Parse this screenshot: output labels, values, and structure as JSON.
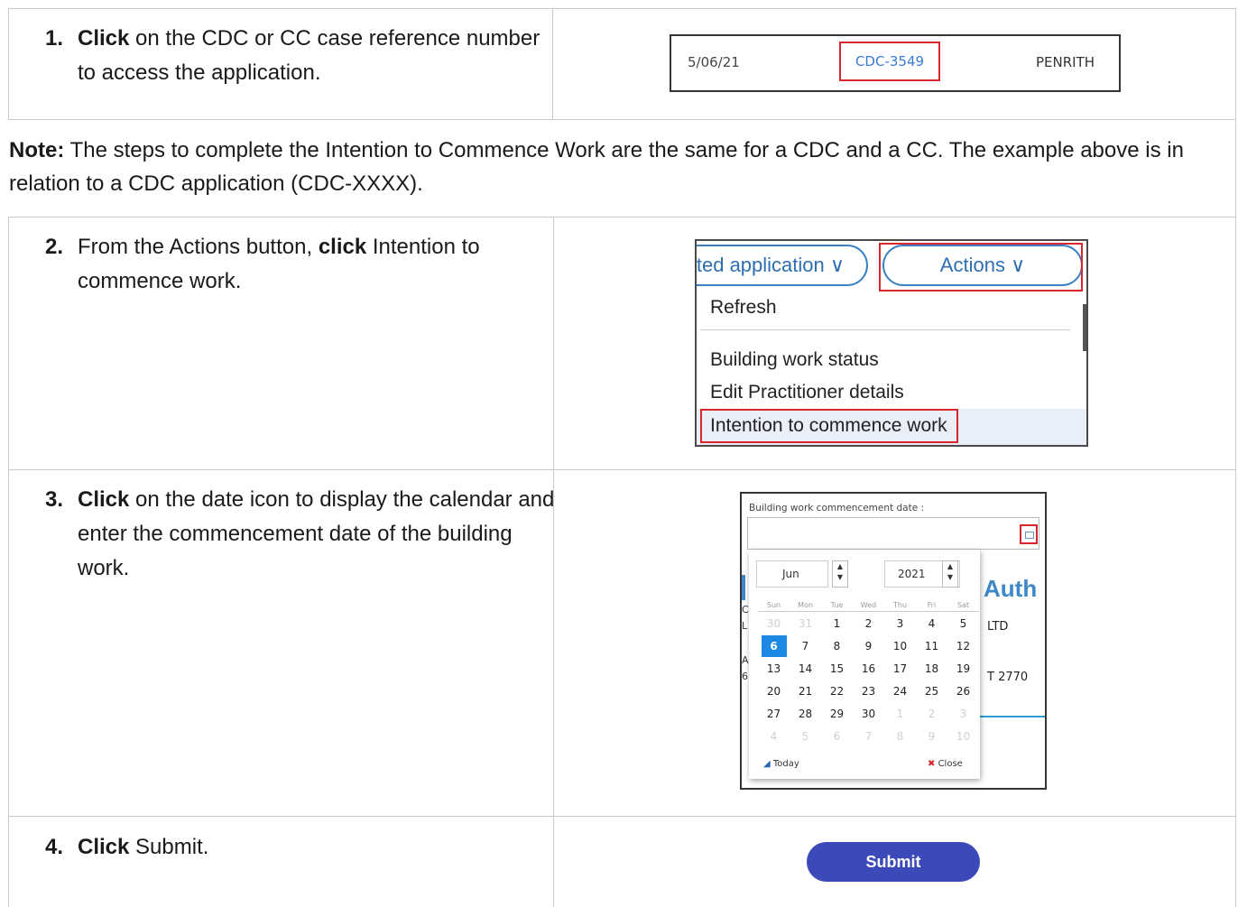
{
  "steps": [
    {
      "num": "1.",
      "bold": "Click",
      "text": " on the CDC or CC case reference number to access the application."
    },
    {
      "num": "2.",
      "pre": "From the Actions button, ",
      "bold": "click",
      "text": " Intention to commence work."
    },
    {
      "num": "3.",
      "bold": "Click",
      "text": " on the date icon to display the calendar and enter the commencement date of the building work."
    },
    {
      "num": "4.",
      "bold": "Click",
      "text": " Submit."
    }
  ],
  "note": {
    "label": "Note:",
    "text": "  The steps to complete the Intention to Commence Work are the same for a CDC and a CC. The example above is in relation to a CDC application (CDC-XXXX)."
  },
  "shot1": {
    "date": "5/06/21",
    "reference": "CDC-3549",
    "location": "PENRITH"
  },
  "shot2": {
    "related_button": "ted application",
    "actions_button": "Actions",
    "menu_items": [
      "Refresh",
      "Building work status",
      "Edit Practitioner details",
      "Intention to commence work"
    ]
  },
  "shot3": {
    "field_label": "Building work commencement date :",
    "month": "Jun",
    "year": "2021",
    "weekdays": [
      "Sun",
      "Mon",
      "Tue",
      "Wed",
      "Thu",
      "Fri",
      "Sat"
    ],
    "weeks": [
      [
        "30",
        "31",
        "1",
        "2",
        "3",
        "4",
        "5"
      ],
      [
        "6",
        "7",
        "8",
        "9",
        "10",
        "11",
        "12"
      ],
      [
        "13",
        "14",
        "15",
        "16",
        "17",
        "18",
        "19"
      ],
      [
        "20",
        "21",
        "22",
        "23",
        "24",
        "25",
        "26"
      ],
      [
        "27",
        "28",
        "29",
        "30",
        "1",
        "2",
        "3"
      ],
      [
        "4",
        "5",
        "6",
        "7",
        "8",
        "9",
        "10"
      ]
    ],
    "selected_day": "6",
    "today_label": "Today",
    "close_label": "Close",
    "bg_title": "Auth",
    "bg_ltd": "LTD",
    "bg_code": "T 2770"
  },
  "shot4": {
    "submit_label": "Submit"
  },
  "icons": {
    "calendar": "calendar-icon",
    "chevron": "chevron-down-icon"
  }
}
